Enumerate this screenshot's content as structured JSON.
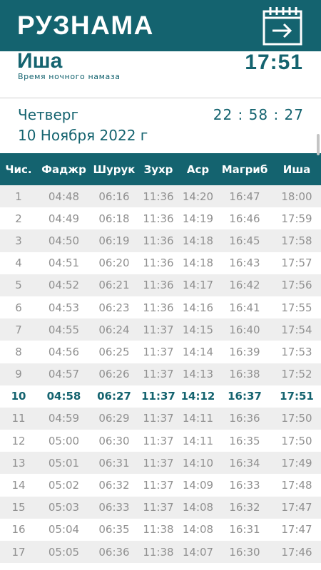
{
  "app": {
    "title": "РУЗНАМА",
    "calendar_icon": "calendar-arrow-icon",
    "colors": {
      "primary": "#14636f",
      "row_alt": "#eeeeee",
      "text_muted": "#909090"
    }
  },
  "current_prayer": {
    "name": "Иша",
    "description": "Время ночного намаза",
    "time": "17:51"
  },
  "date": {
    "weekday": "Четверг",
    "full_date": "10 Ноября 2022 г",
    "clock": "22 : 58 : 27"
  },
  "table": {
    "headers": [
      "Чис.",
      "Фаджр",
      "Шурук",
      "Зухр",
      "Аср",
      "Магриб",
      "Иша"
    ],
    "highlight_day": "10",
    "rows": [
      [
        "1",
        "04:48",
        "06:16",
        "11:36",
        "14:20",
        "16:47",
        "18:00"
      ],
      [
        "2",
        "04:49",
        "06:18",
        "11:36",
        "14:19",
        "16:46",
        "17:59"
      ],
      [
        "3",
        "04:50",
        "06:19",
        "11:36",
        "14:18",
        "16:45",
        "17:58"
      ],
      [
        "4",
        "04:51",
        "06:20",
        "11:36",
        "14:18",
        "16:43",
        "17:57"
      ],
      [
        "5",
        "04:52",
        "06:21",
        "11:36",
        "14:17",
        "16:42",
        "17:56"
      ],
      [
        "6",
        "04:53",
        "06:23",
        "11:36",
        "14:16",
        "16:41",
        "17:55"
      ],
      [
        "7",
        "04:55",
        "06:24",
        "11:37",
        "14:15",
        "16:40",
        "17:54"
      ],
      [
        "8",
        "04:56",
        "06:25",
        "11:37",
        "14:14",
        "16:39",
        "17:53"
      ],
      [
        "9",
        "04:57",
        "06:26",
        "11:37",
        "14:13",
        "16:38",
        "17:52"
      ],
      [
        "10",
        "04:58",
        "06:27",
        "11:37",
        "14:12",
        "16:37",
        "17:51"
      ],
      [
        "11",
        "04:59",
        "06:29",
        "11:37",
        "14:11",
        "16:36",
        "17:50"
      ],
      [
        "12",
        "05:00",
        "06:30",
        "11:37",
        "14:11",
        "16:35",
        "17:50"
      ],
      [
        "13",
        "05:01",
        "06:31",
        "11:37",
        "14:10",
        "16:34",
        "17:49"
      ],
      [
        "14",
        "05:02",
        "06:32",
        "11:37",
        "14:09",
        "16:33",
        "17:48"
      ],
      [
        "15",
        "05:03",
        "06:33",
        "11:37",
        "14:08",
        "16:32",
        "17:47"
      ],
      [
        "16",
        "05:04",
        "06:35",
        "11:38",
        "14:08",
        "16:31",
        "17:47"
      ],
      [
        "17",
        "05:05",
        "06:36",
        "11:38",
        "14:07",
        "16:30",
        "17:46"
      ]
    ]
  }
}
